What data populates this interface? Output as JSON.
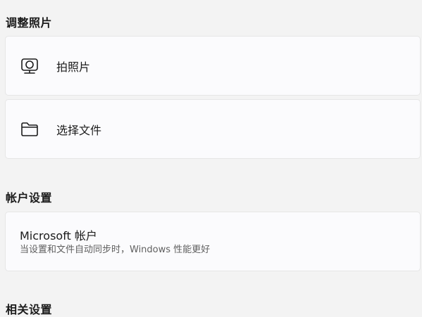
{
  "adjust_photo": {
    "title": "调整照片",
    "take_photo_label": "拍照片",
    "take_photo_icon": "camera-icon",
    "choose_file_label": "选择文件",
    "choose_file_icon": "folder-icon"
  },
  "account_settings": {
    "title": "帐户设置",
    "microsoft_account_title": "Microsoft 帐户",
    "microsoft_account_desc": "当设置和文件自动同步时，Windows 性能更好"
  },
  "related_settings": {
    "title": "相关设置"
  }
}
